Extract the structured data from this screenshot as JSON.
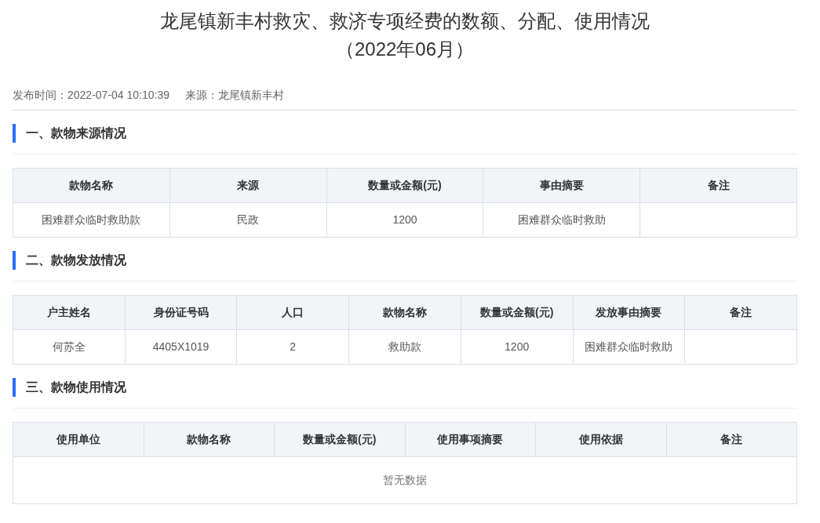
{
  "title_lines": [
    "龙尾镇新丰村救灾、救济专项经费的数额、分配、使用情况",
    "（2022年06月）"
  ],
  "meta": {
    "publish_time": "发布时间：2022-07-04 10:10:39",
    "source": "来源：龙尾镇新丰村"
  },
  "sections": [
    {
      "heading": "一、款物来源情况",
      "columns": [
        "款物名称",
        "来源",
        "数量或金额(元)",
        "事由摘要",
        "备注"
      ],
      "rows": [
        [
          "困难群众临时救助款",
          "民政",
          "1200",
          "困难群众临时救助",
          null
        ]
      ]
    },
    {
      "heading": "二、款物发放情况",
      "columns": [
        "户主姓名",
        "身份证号码",
        "人口",
        "款物名称",
        "数量或金额(元)",
        "发放事由摘要",
        "备注"
      ],
      "rows": [
        [
          "何苏全",
          "4405X1019",
          "2",
          "救助款",
          "1200",
          "困难群众临时救助",
          null
        ]
      ]
    },
    {
      "heading": "三、款物使用情况",
      "columns": [
        "使用单位",
        "款物名称",
        "数量或金额(元)",
        "使用事项摘要",
        "使用依据",
        "备注"
      ],
      "empty_text": "暂无数据"
    }
  ]
}
